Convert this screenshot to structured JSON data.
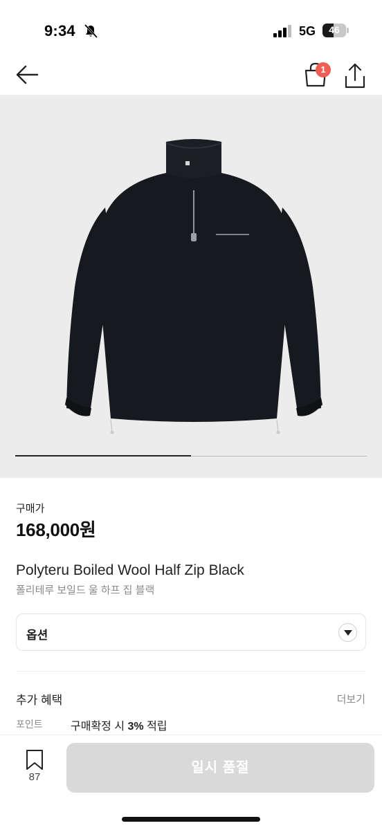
{
  "status_bar": {
    "time": "9:34",
    "network": "5G",
    "battery": "46",
    "battery_level": 0.46
  },
  "nav": {
    "cart_count": "1"
  },
  "gallery": {
    "progress": 0.5
  },
  "product": {
    "price_label": "구매가",
    "price": "168,000원",
    "name": "Polyteru Boiled Wool Half Zip Black",
    "name_ko": "폴리테루 보일드 울 하프 집 블랙"
  },
  "option": {
    "label": "옵션"
  },
  "benefits": {
    "title": "추가 혜택",
    "more": "더보기",
    "point_label": "포인트",
    "point_prefix": "구매확정 시 ",
    "point_value": "3%",
    "point_suffix": " 적립"
  },
  "bottom_bar": {
    "bookmark_count": "87",
    "buy_label": "일시 품절"
  }
}
